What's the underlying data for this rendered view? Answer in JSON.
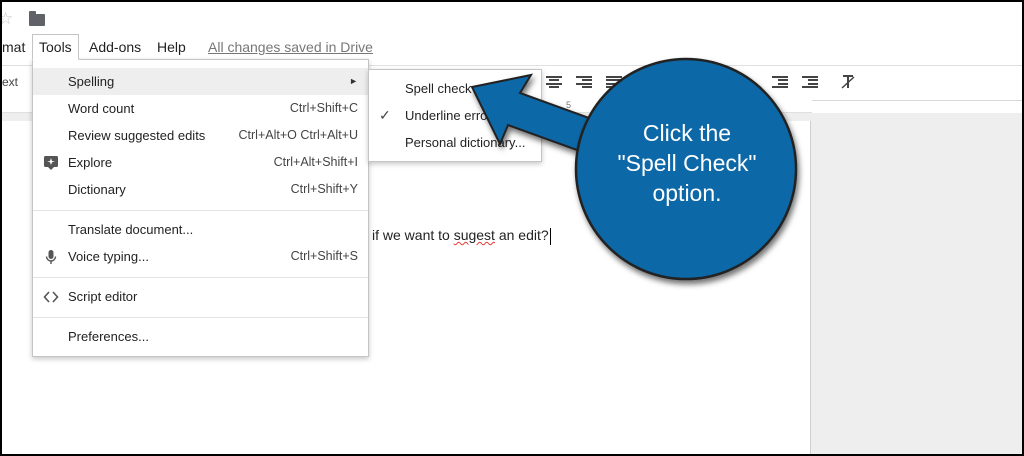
{
  "menubar": {
    "items": [
      {
        "label": "mat"
      },
      {
        "label": "Tools"
      },
      {
        "label": "Add-ons"
      },
      {
        "label": "Help"
      }
    ],
    "saved_status": "All changes saved in Drive"
  },
  "toolbar": {
    "partial_label": "ext",
    "icons": [
      "align-center-icon",
      "align-right-icon",
      "justify-icon",
      "decrease-indent-icon",
      "increase-indent-icon",
      "clear-formatting-icon"
    ]
  },
  "ruler": {
    "mark": "5"
  },
  "tools_menu": {
    "items": [
      {
        "label": "Spelling",
        "shortcut": "",
        "submenu_arrow": "►"
      },
      {
        "label": "Word count",
        "shortcut": "Ctrl+Shift+C"
      },
      {
        "label": "Review suggested edits",
        "shortcut": "Ctrl+Alt+O Ctrl+Alt+U"
      },
      {
        "label": "Explore",
        "shortcut": "Ctrl+Alt+Shift+I",
        "icon": "explore-icon"
      },
      {
        "label": "Dictionary",
        "shortcut": "Ctrl+Shift+Y"
      },
      {
        "label": "Translate document...",
        "shortcut": ""
      },
      {
        "label": "Voice typing...",
        "shortcut": "Ctrl+Shift+S",
        "icon": "microphone-icon"
      },
      {
        "label": "Script editor",
        "shortcut": "",
        "icon": "code-brackets-icon"
      },
      {
        "label": "Preferences...",
        "shortcut": ""
      }
    ]
  },
  "spelling_submenu": {
    "items": [
      {
        "label": "Spell check",
        "checked": false
      },
      {
        "label": "Underline errors",
        "checked": true
      },
      {
        "label": "Personal dictionary...",
        "checked": false
      }
    ]
  },
  "document": {
    "text_before": "if we want to ",
    "misspelled_word": "sugest",
    "text_after": " an edit?"
  },
  "callout": {
    "line1": "Click the",
    "line2": "\"Spell Check\"",
    "line3": "option.",
    "color": "#0b68a8"
  }
}
